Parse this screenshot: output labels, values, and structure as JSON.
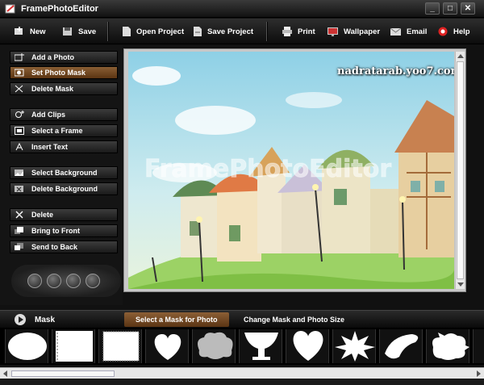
{
  "window": {
    "title": "FramePhotoEditor",
    "controls": [
      "_",
      "□",
      "✕"
    ]
  },
  "toolbar": {
    "new": "New",
    "save": "Save",
    "open_project": "Open Project",
    "save_project": "Save Project",
    "print": "Print",
    "wallpaper": "Wallpaper",
    "email": "Email",
    "help": "Help"
  },
  "sidebar": {
    "items": [
      {
        "label": "Add a Photo",
        "icon": "add-photo-icon"
      },
      {
        "label": "Set Photo Mask",
        "icon": "mask-icon",
        "active": true
      },
      {
        "label": "Delete Mask",
        "icon": "delete-mask-icon"
      },
      {
        "label": "Add Clips",
        "icon": "add-clips-icon"
      },
      {
        "label": "Select a Frame",
        "icon": "frame-icon"
      },
      {
        "label": "Insert Text",
        "icon": "text-icon"
      },
      {
        "label": "Select Background",
        "icon": "background-icon"
      },
      {
        "label": "Delete Background",
        "icon": "delete-background-icon"
      },
      {
        "label": "Delete",
        "icon": "delete-icon"
      },
      {
        "label": "Bring to Front",
        "icon": "bring-front-icon"
      },
      {
        "label": "Send to Back",
        "icon": "send-back-icon"
      }
    ],
    "zoom_controls": [
      "zoom-out-icon",
      "fit-icon",
      "actual-size-icon",
      "zoom-in-icon"
    ]
  },
  "canvas": {
    "watermark": "nadratarab.yoo7.com",
    "overlay_text": "FramePhotoEditor"
  },
  "mask_panel": {
    "label": "Mask",
    "tabs": [
      "Select a Mask for Photo",
      "Change Mask and Photo Size"
    ],
    "active_tab": 0,
    "masks": [
      "oval-soft",
      "rect-frame-left",
      "rect-soft-border",
      "heart-soft",
      "cloud",
      "goblet",
      "heart",
      "starburst",
      "brush-stroke",
      "splat"
    ]
  },
  "colors": {
    "accent": "#7a4e27",
    "background": "#111111",
    "panel": "#2b2b2b"
  }
}
